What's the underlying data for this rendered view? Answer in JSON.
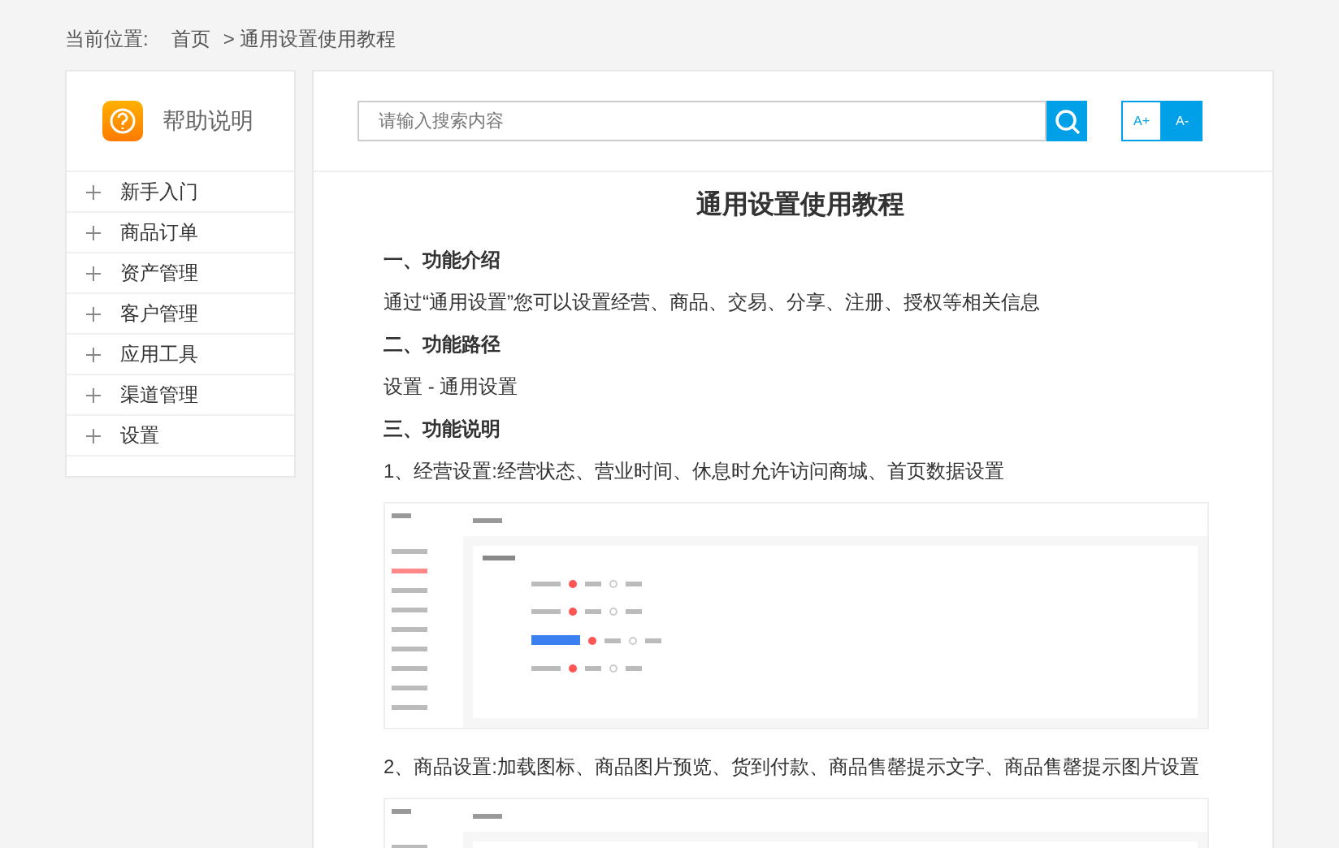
{
  "breadcrumb": {
    "label": "当前位置:",
    "items": [
      "首页",
      "> 通用设置使用教程"
    ]
  },
  "sidebar": {
    "title": "帮助说明",
    "items": [
      {
        "label": "新手入门",
        "expanded": false
      },
      {
        "label": "商品订单",
        "expanded": false
      },
      {
        "label": "资产管理",
        "expanded": false
      },
      {
        "label": "客户管理",
        "expanded": false
      },
      {
        "label": "应用工具",
        "expanded": false
      },
      {
        "label": "渠道管理",
        "expanded": false
      },
      {
        "label": "设置",
        "expanded": false
      }
    ]
  },
  "search": {
    "placeholder": "请输入搜索内容"
  },
  "font_buttons": [
    {
      "label": "A+",
      "selected": false
    },
    {
      "label": "A-",
      "selected": true
    }
  ],
  "article": {
    "title": "通用设置使用教程",
    "blocks": [
      {
        "kind": "heading",
        "text": "一、功能介绍"
      },
      {
        "kind": "paragraph",
        "text": "通过“通用设置”您可以设置经营、商品、交易、分享、注册、授权等相关信息"
      },
      {
        "kind": "heading",
        "text": "二、功能路径"
      },
      {
        "kind": "paragraph",
        "text": "设置 - 通用设置"
      },
      {
        "kind": "heading",
        "text": "三、功能说明"
      },
      {
        "kind": "paragraph",
        "text": "1、经营设置:经营状态、营业时间、休息时允许访问商城、首页数据设置"
      },
      {
        "kind": "image"
      },
      {
        "kind": "paragraph",
        "text": "2、商品设置:加载图标、商品图片预览、货到付款、商品售罄提示文字、商品售罄提示图片设置"
      },
      {
        "kind": "image"
      }
    ]
  }
}
